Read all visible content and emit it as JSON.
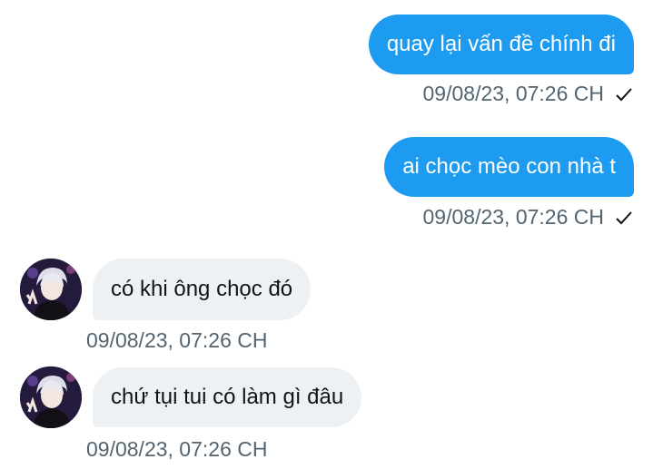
{
  "messages": [
    {
      "direction": "sent",
      "text": "quay lại vấn đề chính đi",
      "time": "09/08/23, 07:26 CH",
      "status_icon": "check-icon"
    },
    {
      "direction": "sent",
      "text": "ai chọc mèo con nhà t",
      "time": "09/08/23, 07:26 CH",
      "status_icon": "check-icon"
    },
    {
      "direction": "received",
      "text": "có khi ông chọc đó",
      "time": "09/08/23, 07:26 CH"
    },
    {
      "direction": "received",
      "text": "chứ tụi tui có làm gì đâu",
      "time": "09/08/23, 07:26 CH"
    }
  ],
  "colors": {
    "sent_bubble": "#1d9bf0",
    "received_bubble": "#eef1f4",
    "timestamp": "#536471"
  }
}
